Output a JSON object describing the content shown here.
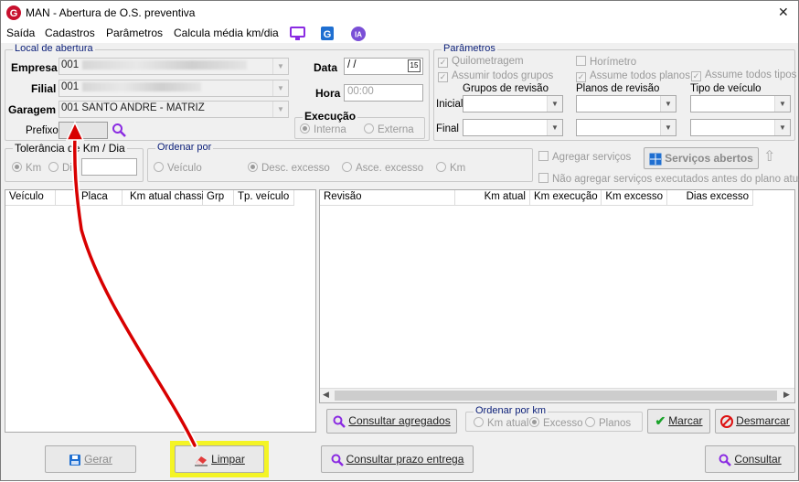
{
  "window": {
    "title": "MAN - Abertura de O.S. preventiva",
    "close_symbol": "✕"
  },
  "menu": {
    "items": [
      "Saída",
      "Cadastros",
      "Parâmetros",
      "Calcula média km/dia"
    ],
    "icon_g": "G",
    "icon_ia": "IA"
  },
  "local": {
    "legend": "Local de abertura",
    "empresa_label": "Empresa",
    "empresa_value": "001",
    "filial_label": "Filial",
    "filial_value": "001",
    "garagem_label": "Garagem",
    "garagem_value": "001 SANTO ANDRE - MATRIZ",
    "prefixo_label": "Prefixo"
  },
  "data": {
    "data_label": "Data",
    "data_value": " /  /",
    "calendar_icon": "15",
    "hora_label": "Hora",
    "hora_value": "00:00"
  },
  "execucao": {
    "legend": "Execução",
    "interna": "Interna",
    "externa": "Externa"
  },
  "parametros": {
    "legend": "Parâmetros",
    "quilometragem": "Quilometragem",
    "horimetro": "Horímetro",
    "assumir_grupos": "Assumir todos grupos",
    "assume_planos": "Assume todos planos",
    "assume_tipos": "Assume todos tipos",
    "grupos_header": "Grupos de revisão",
    "planos_header": "Planos de revisão",
    "tipo_header": "Tipo de veículo",
    "inicial_label": "Inicial",
    "final_label": "Final"
  },
  "tolerancia": {
    "legend": "Tolerância de Km / Dia",
    "km": "Km",
    "dia": "Dia"
  },
  "ordenar": {
    "legend": "Ordenar por",
    "veiculo": "Veículo",
    "desc": "Desc. excesso",
    "asce": "Asce. excesso",
    "km": "Km"
  },
  "servicos": {
    "agregar": "Agregar serviços",
    "nao_agregar": "Não agregar serviços executados antes do plano atual",
    "button": "Serviços abertos",
    "arrow": "⇧"
  },
  "left_table": {
    "columns": [
      "Veículo",
      "Placa",
      "Km atual chassi",
      "Grp",
      "Tp. veículo"
    ]
  },
  "right_table": {
    "columns": [
      "Revisão",
      "Km atual",
      "Km execução",
      "Km excesso",
      "Dias excesso"
    ]
  },
  "ordenar_km": {
    "legend": "Ordenar por km",
    "km_atual": "Km atual",
    "excesso": "Excesso",
    "planos": "Planos"
  },
  "buttons": {
    "consultar_agregados": "Consultar agregados",
    "marcar": "Marcar",
    "desmarcar": "Desmarcar",
    "gerar": "Gerar",
    "limpar": "Limpar",
    "consultar_prazo": "Consultar prazo entrega",
    "consultar": "Consultar"
  },
  "colors": {
    "highlight": "#f4f425",
    "arrow": "#d80000",
    "brand": "#c8102e",
    "purple": "#8a2be2"
  }
}
